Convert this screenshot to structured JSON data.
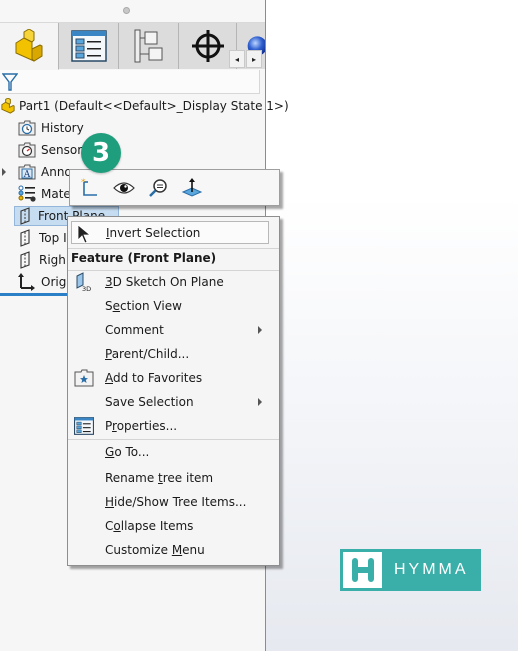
{
  "pane": {
    "tabs": [
      {
        "name": "feature-manager",
        "icon": "part-icon",
        "active": true
      },
      {
        "name": "property-manager",
        "icon": "property-list-icon",
        "active": false
      },
      {
        "name": "configuration-manager",
        "icon": "configuration-tree-icon",
        "active": false
      },
      {
        "name": "dimxpert-manager",
        "icon": "crosshair-icon",
        "active": false
      },
      {
        "name": "display-manager",
        "icon": "sphere-icon",
        "active": false
      }
    ],
    "tab_scroll": {
      "left": "◂",
      "right": "▸"
    },
    "filter_icon": "filter-icon",
    "tree": {
      "root": "Part1  (Default<<Default>_Display State 1>)",
      "items": [
        {
          "label": "History",
          "icon": "history-folder-icon"
        },
        {
          "label": "Sensors",
          "icon": "sensors-folder-icon"
        },
        {
          "label": "Annotations",
          "visible_label": "Anno",
          "icon": "annotations-folder-icon",
          "expandable": true
        },
        {
          "label": "Material",
          "visible_label": "Mate",
          "icon": "material-icon"
        },
        {
          "label": "Front Plane",
          "visible_label": "Front Plane",
          "icon": "plane-icon",
          "selected": true
        },
        {
          "label": "Top Plane",
          "visible_label": "Top I",
          "icon": "plane-icon"
        },
        {
          "label": "Right Plane",
          "visible_label": "Righ",
          "icon": "plane-icon"
        },
        {
          "label": "Origin",
          "visible_label": "Origi",
          "icon": "origin-icon"
        }
      ]
    }
  },
  "badge": {
    "number": "3",
    "color": "#1f9e7e"
  },
  "context_toolbar": {
    "buttons": [
      {
        "name": "sketch-button",
        "icon": "sketch-icon"
      },
      {
        "name": "show-hide-button",
        "icon": "eye-icon"
      },
      {
        "name": "zoom-to-selection-button",
        "icon": "zoom-to-selection-icon"
      },
      {
        "name": "normal-to-button",
        "icon": "normal-to-icon"
      }
    ]
  },
  "context_menu": {
    "top_item": {
      "label_pre": "",
      "mnemonic": "I",
      "label_post": "nvert Selection",
      "icon": "cursor-icon"
    },
    "header": "Feature (Front Plane)",
    "items": [
      {
        "pre": "",
        "mn": "3",
        "post": "D Sketch On Plane",
        "icon": "3d-sketch-icon",
        "submenu": false
      },
      {
        "pre": "S",
        "mn": "e",
        "post": "ction View",
        "icon": "",
        "submenu": false
      },
      {
        "pre": "Comment",
        "mn": "",
        "post": "",
        "icon": "",
        "submenu": true
      },
      {
        "pre": "",
        "mn": "P",
        "post": "arent/Child...",
        "icon": "",
        "submenu": false
      },
      {
        "pre": "",
        "mn": "A",
        "post": "dd to Favorites",
        "icon": "favorites-icon",
        "submenu": false
      },
      {
        "pre": "Save Selection",
        "mn": "",
        "post": "",
        "icon": "",
        "submenu": true
      },
      {
        "pre": "P",
        "mn": "r",
        "post": "operties...",
        "icon": "properties-icon",
        "submenu": false
      },
      {
        "pre": "",
        "mn": "G",
        "post": "o To...",
        "icon": "",
        "submenu": false
      },
      {
        "pre": "Rename ",
        "mn": "t",
        "post": "ree item",
        "icon": "",
        "submenu": false
      },
      {
        "pre": "",
        "mn": "H",
        "post": "ide/Show Tree Items...",
        "icon": "",
        "submenu": false
      },
      {
        "pre": "C",
        "mn": "o",
        "post": "llapse Items",
        "icon": "",
        "submenu": false
      },
      {
        "pre": "Customize ",
        "mn": "M",
        "post": "enu",
        "icon": "",
        "submenu": false
      }
    ]
  },
  "watermark": {
    "letter": "H",
    "text": "HYMMA",
    "color": "#3aafa9"
  }
}
